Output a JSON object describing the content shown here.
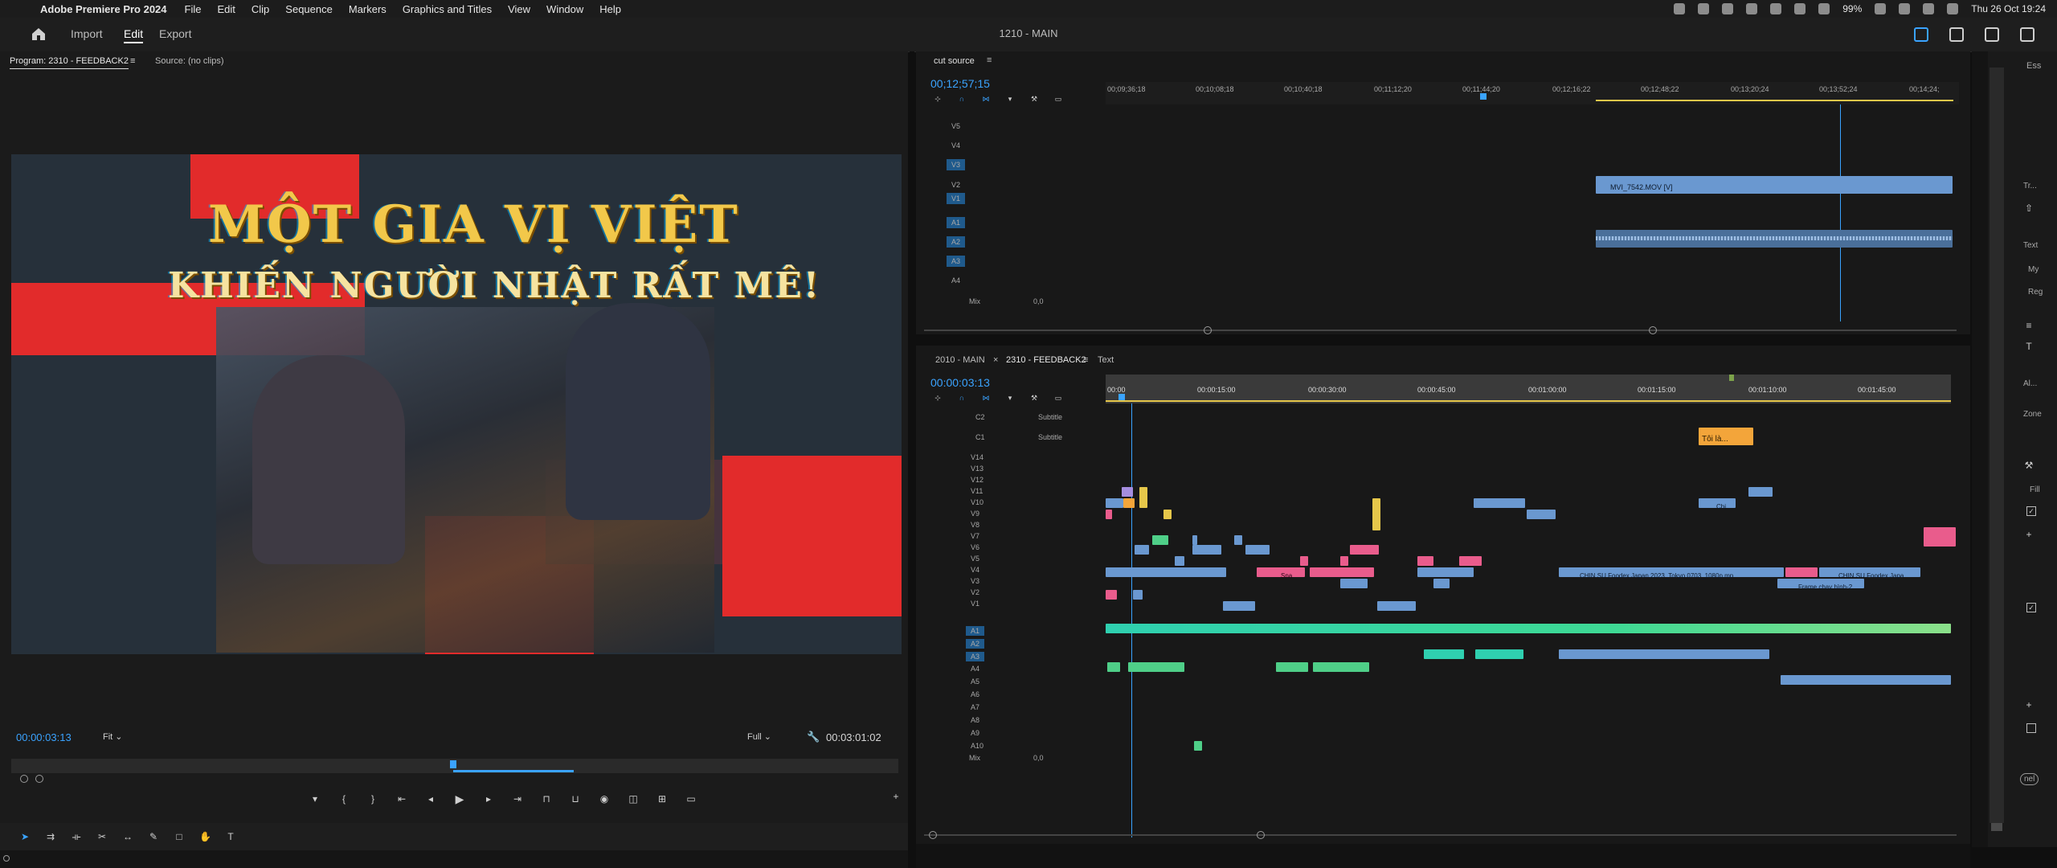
{
  "menubar": {
    "app": "Adobe Premiere Pro 2024",
    "items": [
      "File",
      "Edit",
      "Clip",
      "Sequence",
      "Markers",
      "Graphics and Titles",
      "View",
      "Window",
      "Help"
    ],
    "battery": "99%",
    "datetime": "Thu 26 Oct 19:24"
  },
  "header": {
    "workspaces": [
      "Import",
      "Edit",
      "Export"
    ],
    "active": "Edit",
    "project": "1210 - MAIN"
  },
  "program": {
    "tab_program": "Program: 2310 - FEEDBACK2",
    "tab_source": "Source: (no clips)",
    "title_line1": "MỘT GIA VỊ VIỆT",
    "title_line2": "KHIẾN NGƯỜI NHẬT RẤT MÊ!",
    "timecode": "00:00:03:13",
    "fit": "Fit",
    "quality": "Full",
    "duration": "00:03:01:02"
  },
  "cut_source": {
    "tab": "cut source",
    "timecode": "00;12;57;15",
    "ruler": [
      "00;09;36;18",
      "00;10;08;18",
      "00;10;40;18",
      "00;11;12;20",
      "00;11;44;20",
      "00;12;16;22",
      "00;12;48;22",
      "00;13;20;24",
      "00;13;52;24",
      "00;14;24;"
    ],
    "video_tracks": [
      "V5",
      "V4",
      "V3",
      "V2",
      "V1"
    ],
    "audio_tracks": [
      "A1",
      "A2",
      "A3",
      "A4"
    ],
    "mix": "Mix",
    "mix_value": "0,0",
    "clip_name": "MVI_7542.MOV [V]"
  },
  "feedback": {
    "tabs": [
      "2010 - MAIN",
      "2310 - FEEDBACK2",
      "Text"
    ],
    "timecode": "00:00:03:13",
    "ruler": [
      "00:00",
      "00:00:15:00",
      "00:00:30:00",
      "00:00:45:00",
      "00:01:00:00",
      "00:01:15:00",
      "00:01:10:00",
      "00:01:45:00"
    ],
    "caption_tracks": [
      "C2",
      "C1"
    ],
    "subtitle_label": "Subtitle",
    "subtitle_clip": "Tôi là...",
    "video_tracks": [
      "V14",
      "V13",
      "V12",
      "V11",
      "V10",
      "V9",
      "V8",
      "V7",
      "V6",
      "V5",
      "V4",
      "V3",
      "V2",
      "V1"
    ],
    "audio_tracks": [
      "A1",
      "A2",
      "A3",
      "A4",
      "A5",
      "A6",
      "A7",
      "A8",
      "A9",
      "A10"
    ],
    "mix": "Mix",
    "mix_value": "0,0",
    "clips": {
      "chin1": "CHIN SU Foodex Japan 2023_Tokyo 0703_1080p.mp",
      "chin2": "CHIN SU Foodex Japa",
      "frame": "Frame chạy hình-2",
      "sna": "Sna",
      "chi": "Chi"
    }
  },
  "right_strip": {
    "labels": [
      "Ess",
      "Tr...",
      "Text",
      "My",
      "Reg",
      "Al...",
      "Zone",
      "Fill",
      "nel"
    ]
  },
  "colors": {
    "accent": "#3aa3ff",
    "red": "#e22b2b",
    "gold": "#f2c84a",
    "clip_blue": "#6a98d0",
    "clip_pink": "#e95c8c",
    "clip_yellow": "#e6c74a",
    "clip_green": "#4fcf88"
  }
}
